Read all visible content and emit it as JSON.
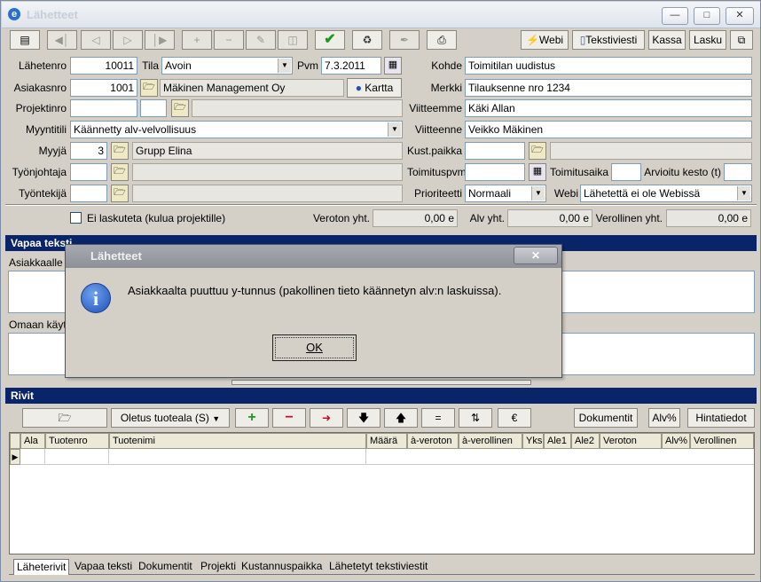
{
  "window": {
    "title": "Lähetteet"
  },
  "toolbar": {
    "webi": "Webi",
    "tekstiviesti": "Tekstiviesti",
    "kassa": "Kassa",
    "lasku": "Lasku"
  },
  "form": {
    "lahetenro_label": "Lähetenro",
    "lahetenro": "10011",
    "tila_label": "Tila",
    "tila": "Avoin",
    "pvm_label": "Pvm",
    "pvm": "7.3.2011",
    "kohde_label": "Kohde",
    "kohde": "Toimitilan uudistus",
    "asiakasnro_label": "Asiakasnro",
    "asiakasnro": "1001",
    "asiakas_nimi": "Mäkinen Management Oy",
    "kartta": "Kartta",
    "merkki_label": "Merkki",
    "merkki": "Tilauksenne nro 1234",
    "projektinro_label": "Projektinro",
    "projektinro": "",
    "viitteemme_label": "Viitteemme",
    "viitteemme": "Käki Allan",
    "myyntitili_label": "Myyntitili",
    "myyntitili": "Käännetty alv-velvollisuus",
    "viitteenne_label": "Viitteenne",
    "viitteenne": "Veikko Mäkinen",
    "myyja_label": "Myyjä",
    "myyja": "3",
    "myyja_nimi": "Grupp Elina",
    "kustpaikka_label": "Kust.paikka",
    "kustpaikka": "",
    "tyonjohtaja_label": "Työnjohtaja",
    "toimituspvm_label": "Toimituspvm",
    "toimitusaika_label": "Toimitusaika",
    "arvioitu_kesto_label": "Arvioitu kesto (t)",
    "tyontekija_label": "Työntekijä",
    "prioriteetti_label": "Prioriteetti",
    "prioriteetti": "Normaali",
    "webi_label": "Webi",
    "webi": "Lähetettä ei ole Webissä",
    "ei_laskuteta": "Ei laskuteta (kulua projektille)",
    "veroton_label": "Veroton yht.",
    "veroton": "0,00 e",
    "alv_label": "Alv yht.",
    "alv": "0,00 e",
    "verollinen_label": "Verollinen yht.",
    "verollinen": "0,00 e"
  },
  "sections": {
    "vapaa_teksti": "Vapaa teksti",
    "asiakkaalle": "Asiakkaalle",
    "omaan_kayttoon": "Omaan käyt",
    "rivit": "Rivit"
  },
  "rows_toolbar": {
    "oletus_tuoteala": "Oletus tuoteala (S)",
    "dokumentit": "Dokumentit",
    "alv_pct": "Alv%",
    "hintatiedot": "Hintatiedot"
  },
  "grid_columns": [
    "Ala",
    "Tuotenro",
    "Tuotenimi",
    "Määrä",
    "à-veroton",
    "à-verollinen",
    "Yks",
    "Ale1",
    "Ale2",
    "Veroton",
    "Alv%",
    "Verollinen"
  ],
  "tabs": [
    "Läheterivit",
    "Vapaa teksti",
    "Dokumentit",
    "Projekti",
    "Kustannuspaikka",
    "Lähetetyt tekstiviestit"
  ],
  "dialog": {
    "title": "Lähetteet",
    "message": "Asiakkaalta puuttuu y-tunnus (pakollinen tieto käännetyn alv:n laskuissa).",
    "ok": "OK"
  }
}
